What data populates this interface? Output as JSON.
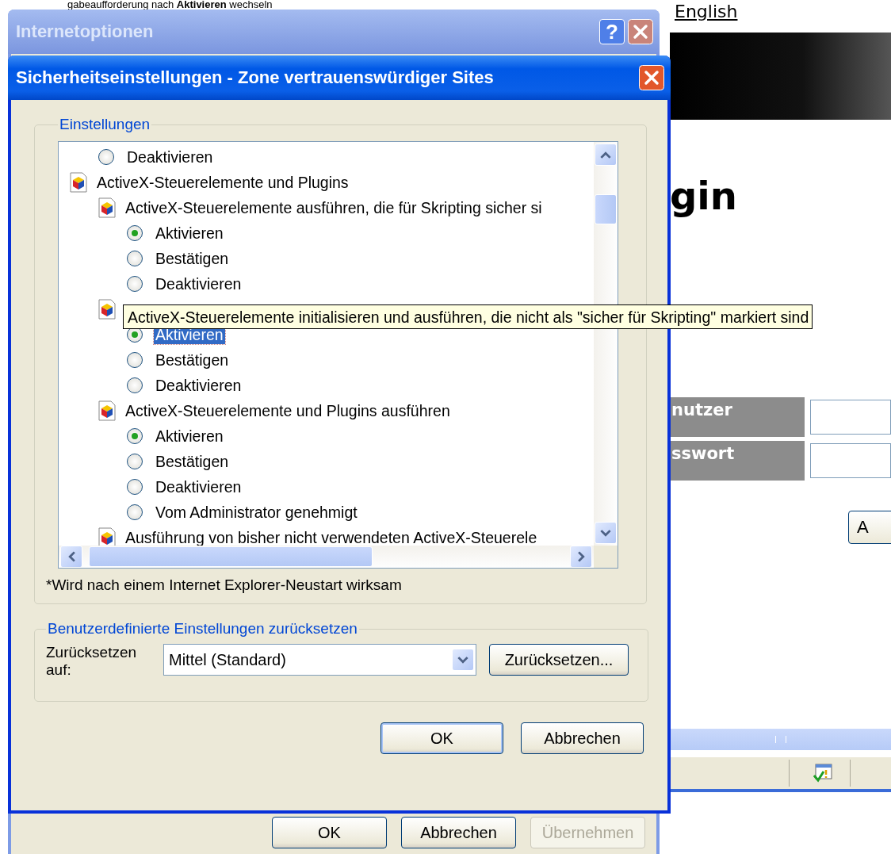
{
  "page": {
    "intro_text": "gabeaufforderung nach **Aktivieren** wechseln",
    "language_link": "English",
    "heading": "gin",
    "fields": [
      {
        "label": "nutzer"
      },
      {
        "label": "sswort"
      }
    ],
    "button": "A"
  },
  "options_window": {
    "title": "Internetoptionen",
    "help_button": "?",
    "buttons": [
      {
        "label": "OK",
        "disabled": false
      },
      {
        "label": "Abbrechen",
        "disabled": false
      },
      {
        "label": "Übernehmen",
        "disabled": true
      }
    ]
  },
  "dialog": {
    "title": "Sicherheitseinstellungen - Zone vertrauenswürdiger Sites",
    "settings": {
      "legend": "Einstellungen",
      "items": [
        {
          "kind": "option",
          "label": "Deaktivieren",
          "checked": false,
          "selected": false
        },
        {
          "kind": "category",
          "label": "ActiveX-Steuerelemente und Plugins",
          "children": [
            {
              "kind": "category",
              "label": "ActiveX-Steuerelemente ausführen, die für Skripting sicher si",
              "children": [
                {
                  "kind": "option",
                  "label": "Aktivieren",
                  "checked": true,
                  "selected": false
                },
                {
                  "kind": "option",
                  "label": "Bestätigen",
                  "checked": false,
                  "selected": false
                },
                {
                  "kind": "option",
                  "label": "Deaktivieren",
                  "checked": false,
                  "selected": false
                }
              ]
            },
            {
              "kind": "category",
              "children": [
                {
                  "kind": "option",
                  "label": "Aktivieren",
                  "checked": true,
                  "selected": true
                },
                {
                  "kind": "option",
                  "label": "Bestätigen",
                  "checked": false,
                  "selected": false
                },
                {
                  "kind": "option",
                  "label": "Deaktivieren",
                  "checked": false,
                  "selected": false
                }
              ]
            },
            {
              "kind": "category",
              "label": "ActiveX-Steuerelemente und Plugins ausführen",
              "children": [
                {
                  "kind": "option",
                  "label": "Aktivieren",
                  "checked": true,
                  "selected": false
                },
                {
                  "kind": "option",
                  "label": "Bestätigen",
                  "checked": false,
                  "selected": false
                },
                {
                  "kind": "option",
                  "label": "Deaktivieren",
                  "checked": false,
                  "selected": false
                },
                {
                  "kind": "option",
                  "label": "Vom Administrator genehmigt",
                  "checked": false,
                  "selected": false
                }
              ]
            },
            {
              "kind": "category",
              "label": "Ausführung von bisher nicht verwendeten ActiveX-Steuerele"
            }
          ]
        }
      ],
      "tooltip": "ActiveX-Steuerelemente initialisieren und ausführen, die nicht als \"sicher für Skripting\" markiert sind",
      "note": "*Wird nach einem Internet Explorer-Neustart wirksam"
    },
    "reset": {
      "legend": "Benutzerdefinierte Einstellungen zurücksetzen",
      "label": "Zurücksetzen auf:",
      "value": "Mittel (Standard)",
      "button": "Zurücksetzen..."
    },
    "buttons": [
      {
        "label": "OK",
        "default": true
      },
      {
        "label": "Abbrechen",
        "default": false
      }
    ]
  }
}
